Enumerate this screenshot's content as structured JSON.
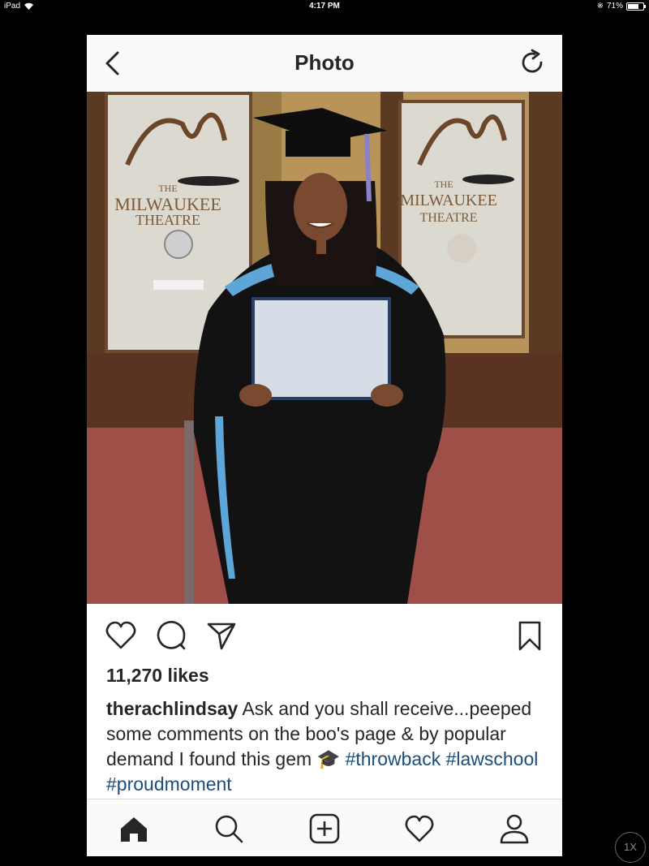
{
  "status_bar": {
    "device": "iPad",
    "time": "4:17 PM",
    "battery": "71%",
    "battery_level": 0.71
  },
  "nav": {
    "title": "Photo"
  },
  "photo": {
    "sign_left": {
      "line1": "THE",
      "line2": "MILWAUKEE",
      "line3": "THEATRE"
    },
    "sign_right": {
      "line1": "THE",
      "line2": "MILWAUKEE",
      "line3": "THEATRE"
    }
  },
  "post": {
    "likes": "11,270 likes",
    "username": "therachlindsay",
    "caption": " Ask and you shall receive...peeped some comments on the boo's page & by popular demand I found this gem 🎓 ",
    "hashtags": "#throwback #lawschool #proudmoment"
  },
  "icons": {
    "back": "chevron-left-icon",
    "refresh": "refresh-icon",
    "like": "heart-icon",
    "comment": "comment-icon",
    "share": "send-icon",
    "save": "bookmark-icon",
    "tabs": [
      "home-icon",
      "search-icon",
      "add-post-icon",
      "activity-heart-icon",
      "profile-icon"
    ]
  },
  "zoom": {
    "label": "1X"
  }
}
